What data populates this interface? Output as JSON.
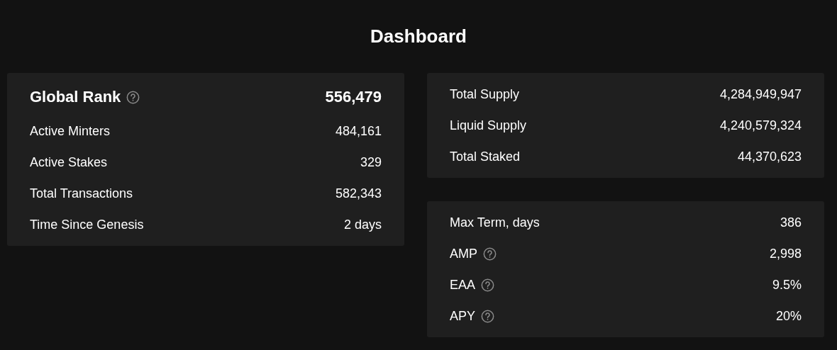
{
  "title": "Dashboard",
  "rank_card": {
    "rank": {
      "label": "Global Rank",
      "help": true,
      "value": "556,479"
    },
    "rows": [
      {
        "label": "Active Minters",
        "help": false,
        "value": "484,161"
      },
      {
        "label": "Active Stakes",
        "help": false,
        "value": "329"
      },
      {
        "label": "Total Transactions",
        "help": false,
        "value": "582,343"
      },
      {
        "label": "Time Since Genesis",
        "help": false,
        "value": "2 days"
      }
    ]
  },
  "supply_card": {
    "rows": [
      {
        "label": "Total Supply",
        "help": false,
        "value": "4,284,949,947"
      },
      {
        "label": "Liquid Supply",
        "help": false,
        "value": "4,240,579,324"
      },
      {
        "label": "Total Staked",
        "help": false,
        "value": "44,370,623"
      }
    ]
  },
  "terms_card": {
    "rows": [
      {
        "label": "Max Term, days",
        "help": false,
        "value": "386"
      },
      {
        "label": "AMP",
        "help": true,
        "value": "2,998"
      },
      {
        "label": "EAA",
        "help": true,
        "value": "9.5%"
      },
      {
        "label": "APY",
        "help": true,
        "value": "20%"
      }
    ]
  }
}
